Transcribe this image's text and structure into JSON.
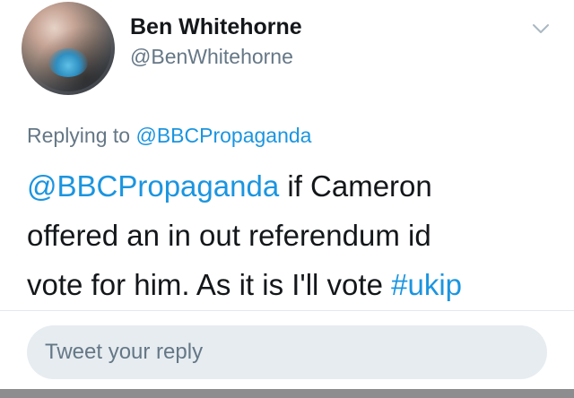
{
  "user": {
    "display_name": "Ben Whitehorne",
    "handle": "@BenWhitehorne",
    "avatar_icon": "profile-photo"
  },
  "tweet": {
    "replying_prefix": "Replying to ",
    "replying_to": "@BBCPropaganda",
    "mention": "@BBCPropaganda",
    "line1_rest": " if Cameron",
    "line2": "offered an in out referendum id",
    "line3_text": "vote for him. As it is I'll vote ",
    "hashtag": "#ukip",
    "menu_icon": "chevron-down-icon"
  },
  "reply": {
    "placeholder": "Tweet your reply"
  },
  "colors": {
    "link": "#1b95e0",
    "secondary_text": "#657786",
    "reply_field_bg": "#e6ecf0"
  }
}
